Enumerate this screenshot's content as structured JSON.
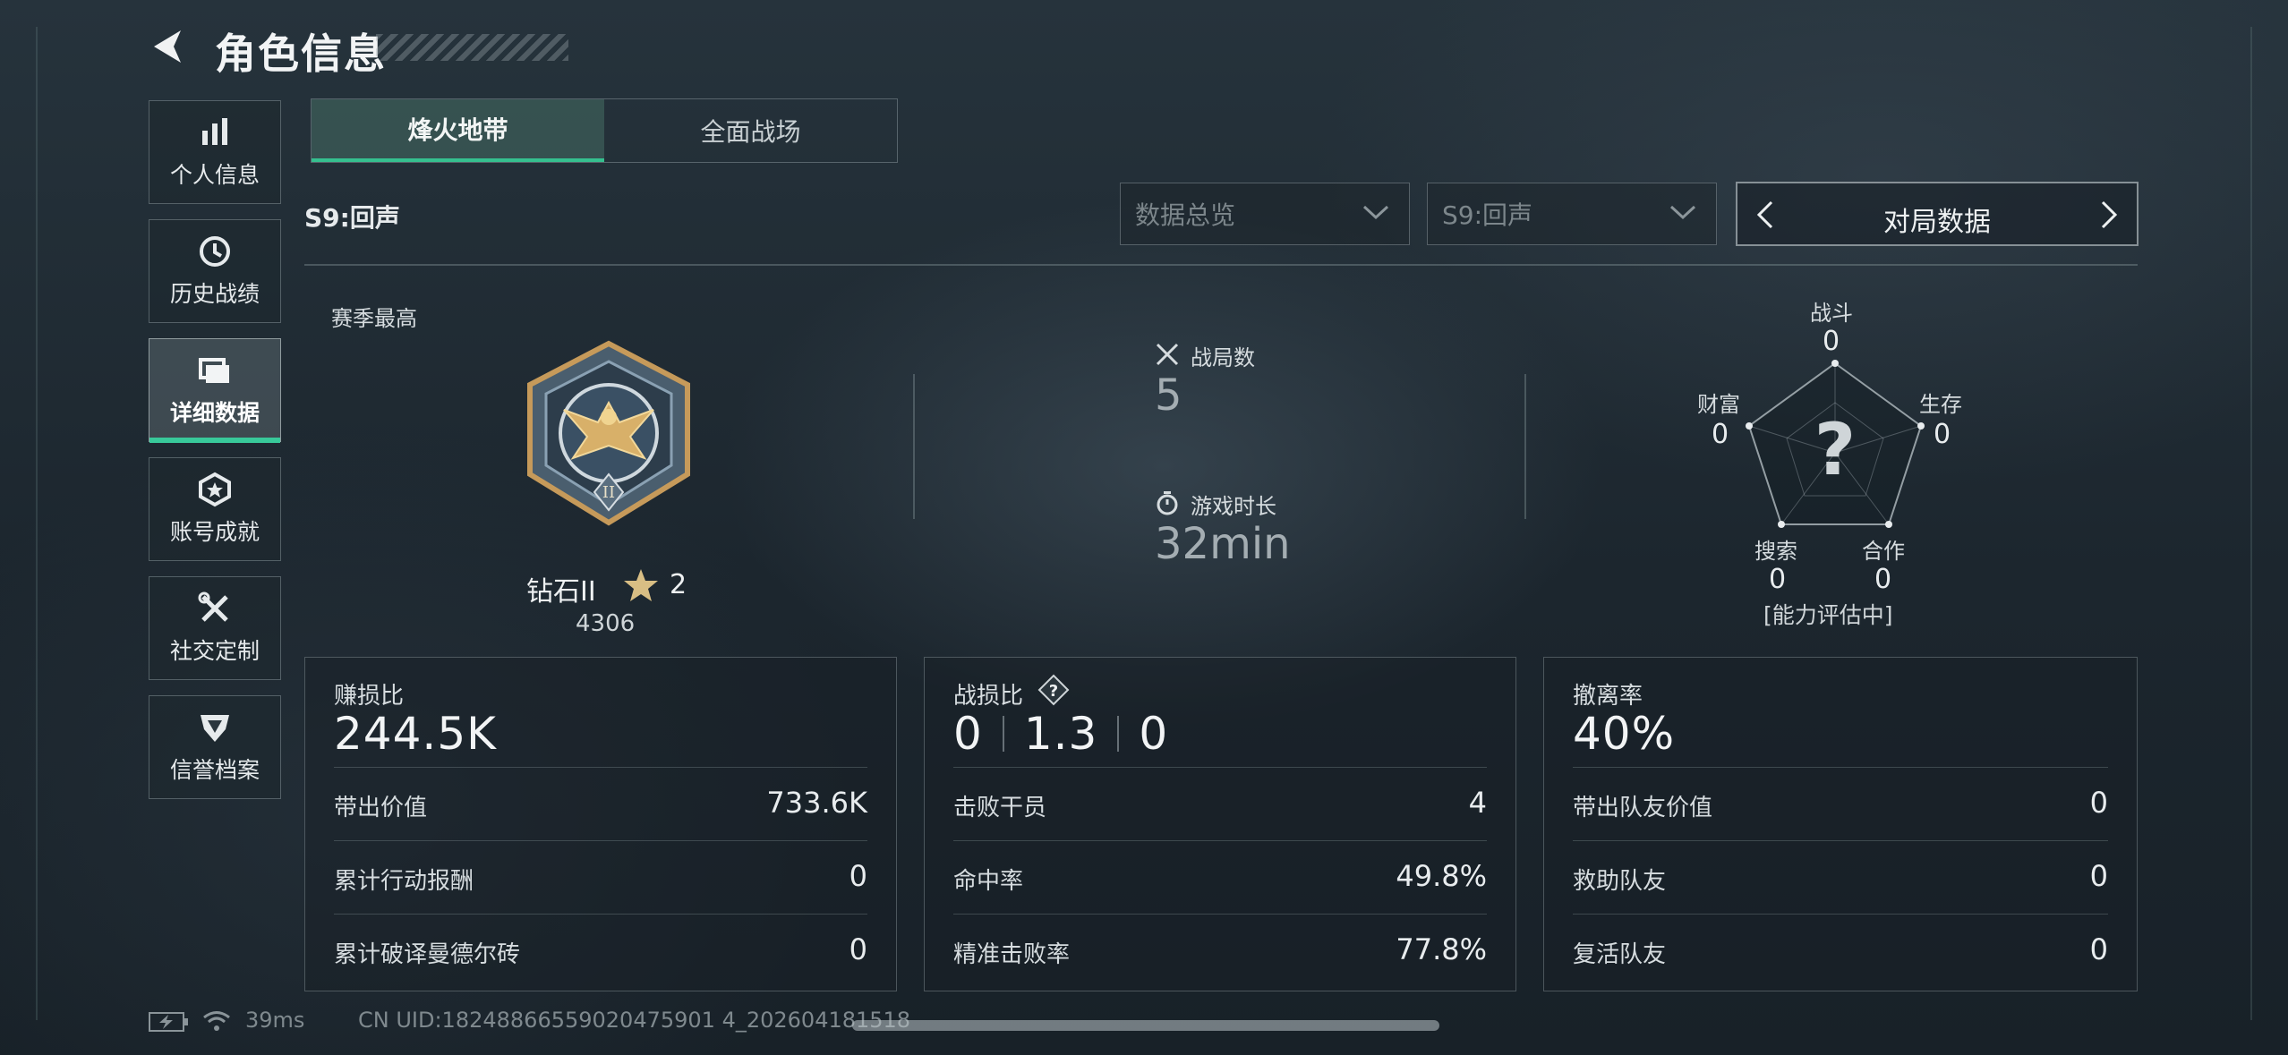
{
  "header": {
    "title": "角色信息"
  },
  "sidebar": {
    "items": [
      {
        "label": "个人信息",
        "icon": "bar-chart-icon"
      },
      {
        "label": "历史战绩",
        "icon": "history-clock-icon"
      },
      {
        "label": "详细数据",
        "icon": "folder-icon",
        "active": true
      },
      {
        "label": "账号成就",
        "icon": "achievement-badge-icon"
      },
      {
        "label": "社交定制",
        "icon": "tools-icon"
      },
      {
        "label": "信誉档案",
        "icon": "shield-wing-icon"
      }
    ]
  },
  "tabs": [
    {
      "label": "烽火地带",
      "active": true
    },
    {
      "label": "全面战场",
      "active": false
    }
  ],
  "filters": {
    "season_label": "S9:回声",
    "dropdown_overview": "数据总览",
    "dropdown_season": "S9:回声",
    "view_selector": "对局数据"
  },
  "rank": {
    "section_label": "赛季最高",
    "name": "钻石II",
    "stars": "2",
    "score": "4306",
    "emblem_numeral": "II"
  },
  "summary": {
    "matches_label": "战局数",
    "matches_value": "5",
    "playtime_label": "游戏时长",
    "playtime_value": "32min"
  },
  "radar": {
    "axes": [
      {
        "label": "战斗",
        "value": "0"
      },
      {
        "label": "生存",
        "value": "0"
      },
      {
        "label": "合作",
        "value": "0"
      },
      {
        "label": "搜索",
        "value": "0"
      },
      {
        "label": "财富",
        "value": "0"
      }
    ],
    "center_mark": "?",
    "status": "[能力评估中]"
  },
  "cards": {
    "profit": {
      "title": "赚损比",
      "value": "244.5K",
      "rows": [
        {
          "label": "带出价值",
          "value": "733.6K"
        },
        {
          "label": "累计行动报酬",
          "value": "0"
        },
        {
          "label": "累计破译曼德尔砖",
          "value": "0"
        }
      ]
    },
    "combat": {
      "title": "战损比",
      "help": "?",
      "values": [
        "0",
        "1.3",
        "0"
      ],
      "rows": [
        {
          "label": "击败干员",
          "value": "4"
        },
        {
          "label": "命中率",
          "value": "49.8%"
        },
        {
          "label": "精准击败率",
          "value": "77.8%"
        }
      ]
    },
    "extract": {
      "title": "撤离率",
      "value": "40%",
      "rows": [
        {
          "label": "带出队友价值",
          "value": "0"
        },
        {
          "label": "救助队友",
          "value": "0"
        },
        {
          "label": "复活队友",
          "value": "0"
        }
      ]
    }
  },
  "status": {
    "ping": "39ms",
    "uid": "CN UID:18248866559020475901 4_202604181518"
  }
}
